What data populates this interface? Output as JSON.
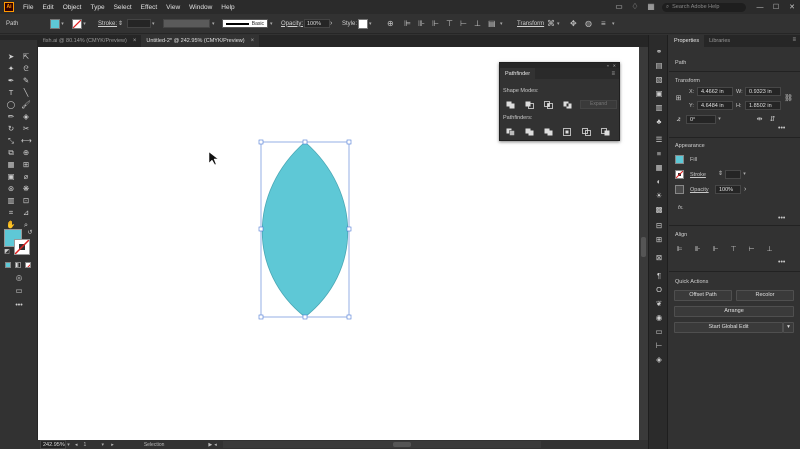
{
  "app": {
    "logo": "Ai"
  },
  "menu": [
    "File",
    "Edit",
    "Object",
    "Type",
    "Select",
    "Effect",
    "View",
    "Window",
    "Help"
  ],
  "search": {
    "placeholder": "Search Adobe Help"
  },
  "window_controls": {
    "minimize": "—",
    "maximize": "☐",
    "close": "✕"
  },
  "control_bar": {
    "selection_label": "Path",
    "fill_color": "#5ec8d6",
    "stroke_label": "Stroke:",
    "stroke_style": "Basic",
    "opacity_label": "Opacity:",
    "opacity_value": "100%",
    "style_label": "Style:",
    "transform_label": "Transform"
  },
  "tabs": [
    {
      "label": "fish.ai @ 80.14% (CMYK/Preview)",
      "close": "×"
    },
    {
      "label": "Untitled-2* @ 242.95% (CMYK/Preview)",
      "close": "×"
    }
  ],
  "status_bar": {
    "zoom": "242.95%",
    "page": "1",
    "tool": "Selection"
  },
  "pathfinder": {
    "title": "Pathfinder",
    "shape_modes_label": "Shape Modes:",
    "pathfinders_label": "Pathfinders:",
    "expand_label": "Expand"
  },
  "properties": {
    "tabs": [
      "Properties",
      "Libraries"
    ],
    "object_type": "Path",
    "transform": {
      "title": "Transform",
      "x_label": "X:",
      "x_value": "4.4662 in",
      "y_label": "Y:",
      "y_value": "4.6484 in",
      "w_label": "W:",
      "w_value": "0.9323 in",
      "h_label": "H:",
      "h_value": "1.8502 in",
      "angle_value": "0°"
    },
    "appearance": {
      "title": "Appearance",
      "fill_label": "Fill",
      "stroke_label": "Stroke",
      "opacity_label": "Opacity",
      "opacity_value": "100%",
      "fx_label": "fx."
    },
    "align": {
      "title": "Align"
    },
    "quick_actions": {
      "title": "Quick Actions",
      "offset_path": "Offset Path",
      "recolor": "Recolor",
      "arrange": "Arrange",
      "start_global_edit": "Start Global Edit"
    }
  },
  "shape": {
    "fill": "#5ec8d6",
    "stroke": "#4aa7b5",
    "bbox_color": "#4d7bd6"
  }
}
